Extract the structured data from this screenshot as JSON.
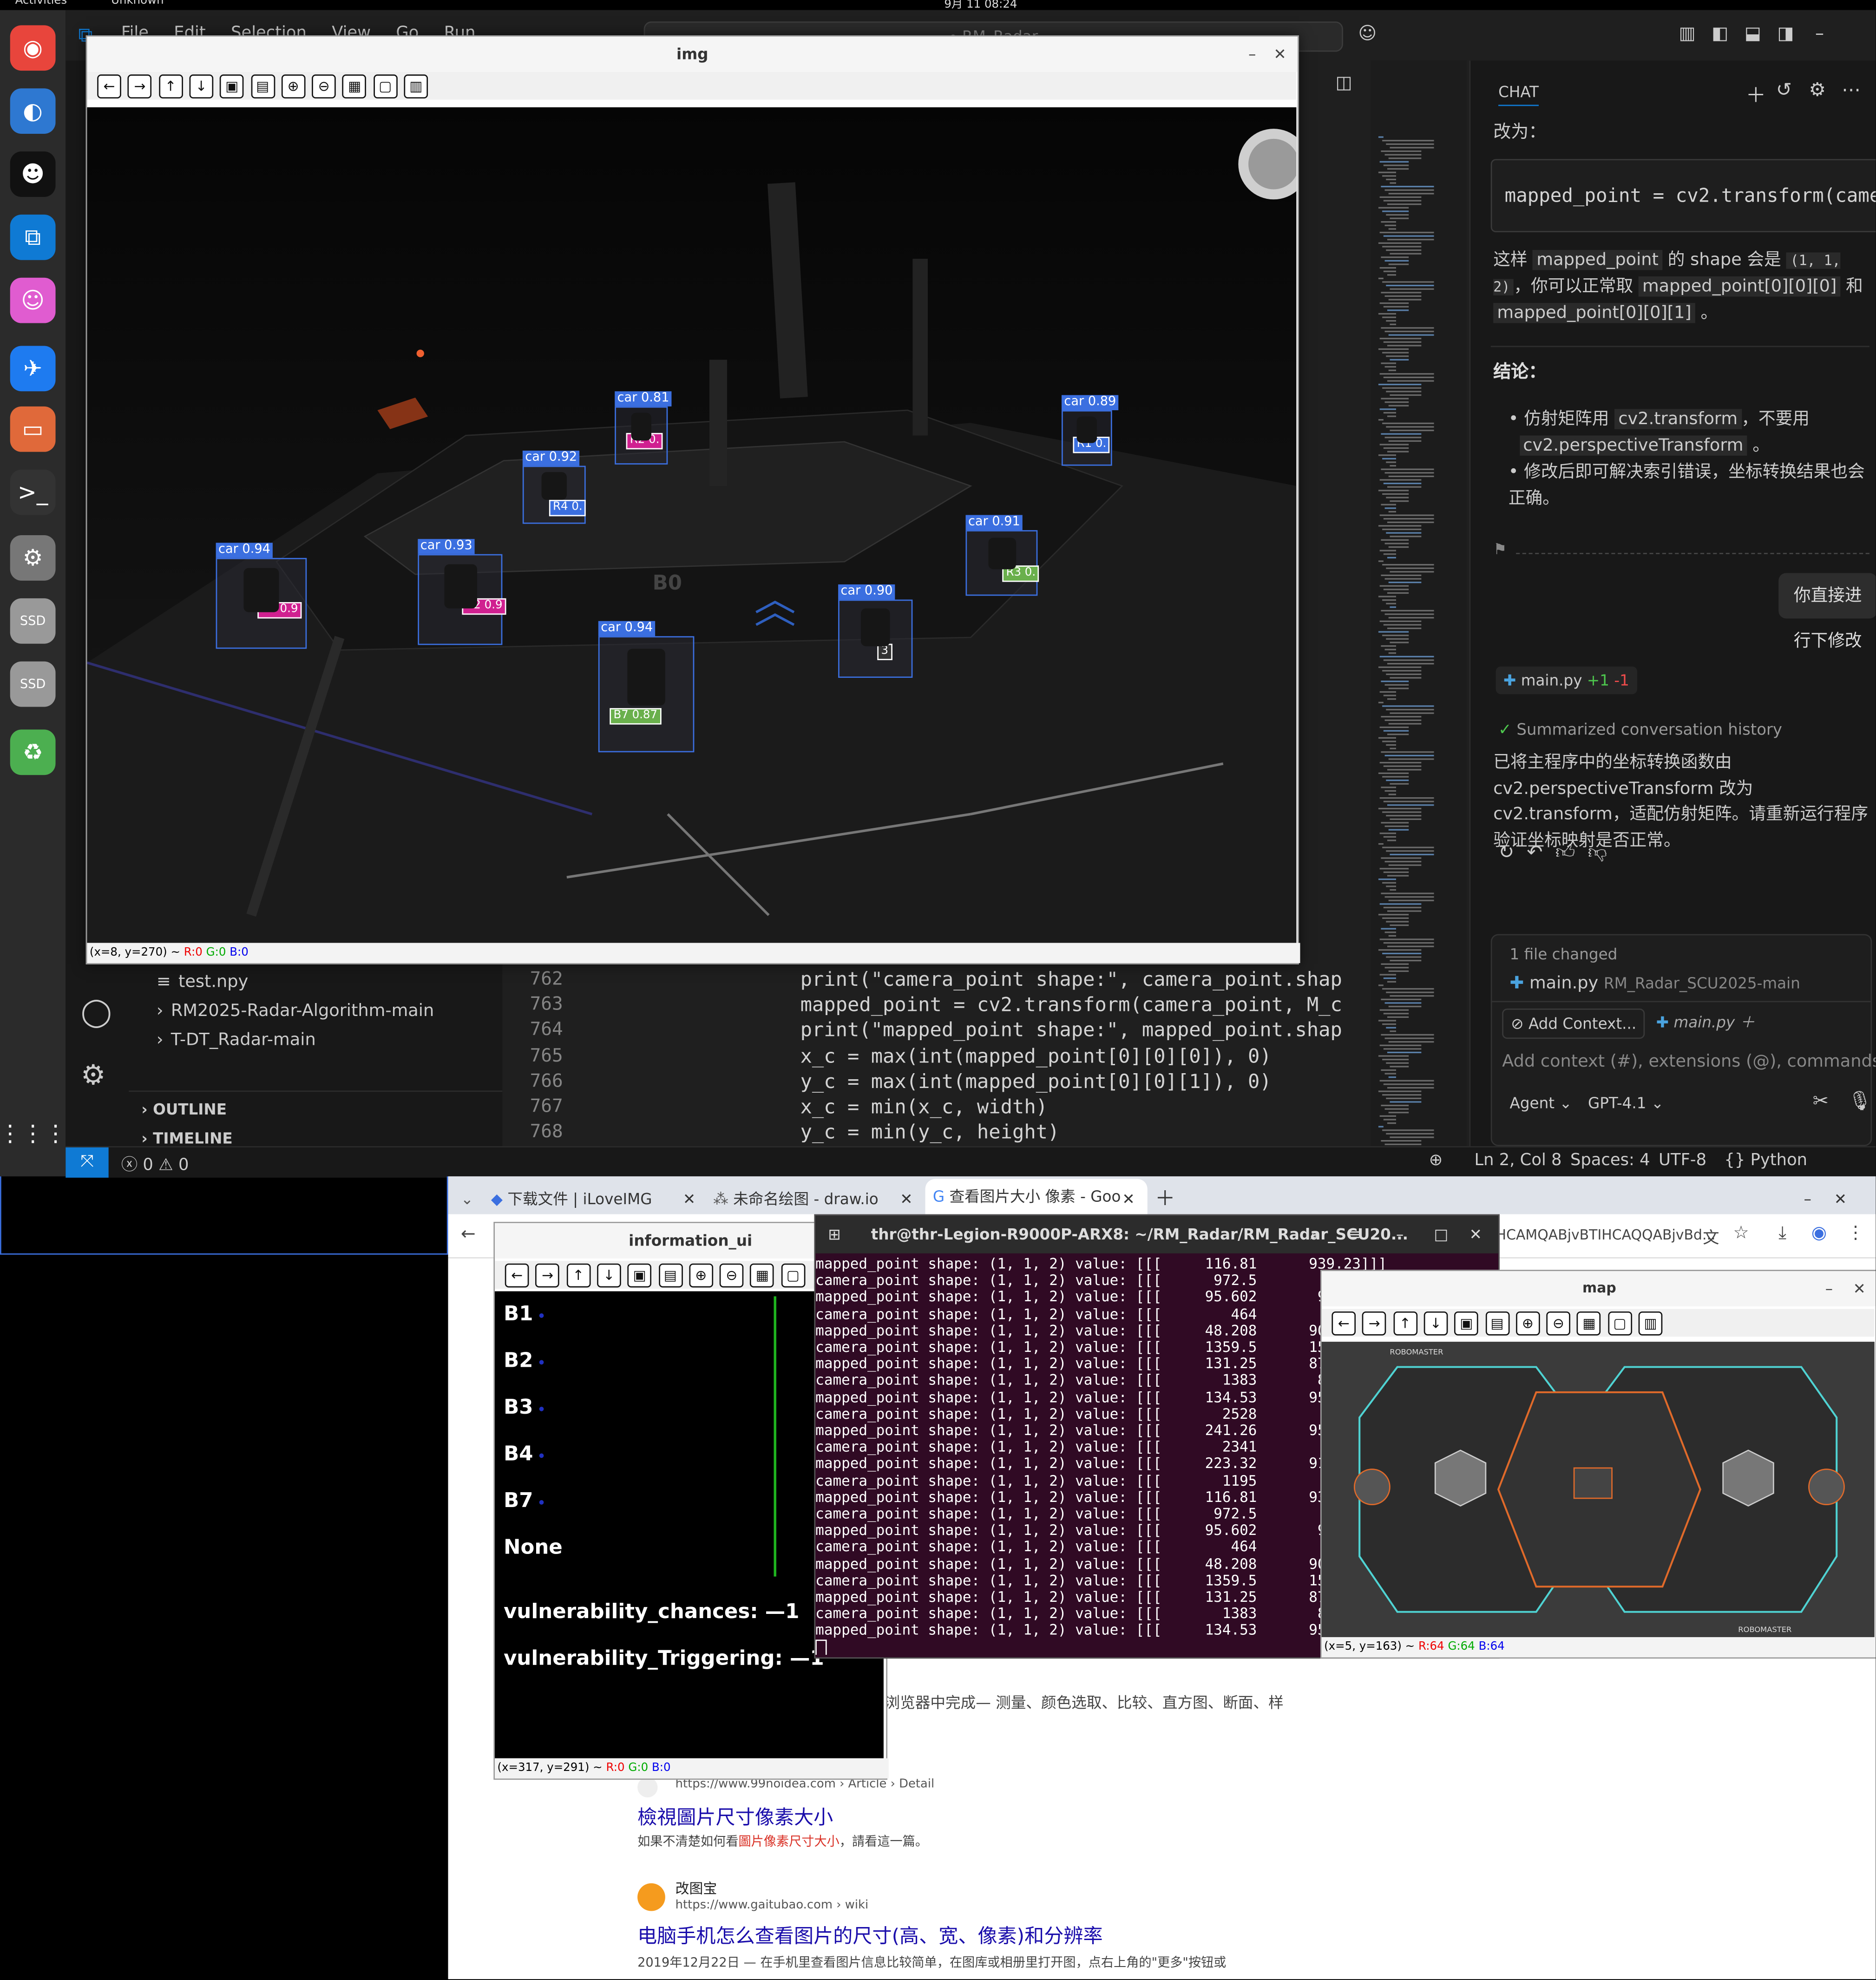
{
  "topbar": {
    "activities": "Activities",
    "app": "Unknown",
    "clock": "9月 11 08:24"
  },
  "dock": {
    "items": [
      {
        "name": "chrome-icon",
        "color": "#e8453c"
      },
      {
        "name": "thunderbird-icon",
        "color": "#2e78d1"
      },
      {
        "name": "qq-icon",
        "color": "#111"
      },
      {
        "name": "vscode-icon",
        "color": "#0f7ad4"
      },
      {
        "name": "cat-app-icon",
        "color": "#e05cd0"
      },
      {
        "name": "feishu-icon",
        "color": "#1e7bf0"
      },
      {
        "name": "files-icon",
        "color": "#e0693a"
      },
      {
        "name": "terminal-icon",
        "color": "#333"
      },
      {
        "name": "settings-icon",
        "color": "#777"
      },
      {
        "name": "ssd-drive-icon",
        "color": "#999",
        "label": "SSD"
      },
      {
        "name": "ssd-drive-icon",
        "color": "#999",
        "label": "SSD"
      },
      {
        "name": "trash-icon",
        "color": "#4caf50"
      },
      {
        "name": "app-grid-icon",
        "color": "#fff"
      }
    ]
  },
  "vscode": {
    "menu": [
      "File",
      "Edit",
      "Selection",
      "View",
      "Go",
      "Run"
    ],
    "search_placeholder": "RM_Radar",
    "explorer": [
      {
        "name": "test.npy",
        "icon": "≡"
      },
      {
        "name": "RM2025-Radar-Algorithm-main",
        "icon": "›"
      },
      {
        "name": "T-DT_Radar-main",
        "icon": "›"
      }
    ],
    "outline": "OUTLINE",
    "timeline": "TIMELINE",
    "line_numbers": [
      "762",
      "763",
      "764",
      "765",
      "766",
      "767",
      "768"
    ],
    "code": [
      "print(\"camera_point shape:\", camera_point.shap",
      "mapped_point = cv2.transform(camera_point, M_c",
      "print(\"mapped_point shape:\", mapped_point.shap",
      "x_c = max(int(mapped_point[0][0][0]), 0)",
      "y_c = max(int(mapped_point[0][0][1]), 0)",
      "x_c = min(x_c, width)",
      "y_c = min(y_c, height)"
    ],
    "status": {
      "errors": "0",
      "warnings": "0",
      "position": "Ln 2, Col 8",
      "spaces": "Spaces: 4",
      "encoding": "UTF-8",
      "language": "Python"
    }
  },
  "chat": {
    "header": "CHAT",
    "change_to": "改为：",
    "code_snippet": "mapped_point = cv2.transform(camera_po",
    "para1_a": "这样",
    "para1_b": "mapped_point",
    "para1_c": "的 shape 会是",
    "para1_d": "(1, 1, 2)",
    "para1_e": "，你可以正常取",
    "para1_f": "mapped_point[0][0][0]",
    "para1_g": "和",
    "para1_h": "mapped_point[0][0][1]",
    "para1_i": "。",
    "conclusion": "结论：",
    "bullet1_a": "仿射矩阵用",
    "bullet1_b": "cv2.transform",
    "bullet1_c": "，不要用",
    "bullet1_d": "cv2.perspectiveTransform",
    "bullet1_e": "。",
    "bullet2": "修改后即可解决索引错误，坐标转换结果也会正确。",
    "user_msg": "你直接进行下修改",
    "file_chip": "main.py",
    "plus": "+1",
    "minus": "-1",
    "summarized": "Summarized conversation history",
    "reply": "已将主程序中的坐标转换函数由 cv2.perspectiveTransform 改为 cv2.transform，适配仿射矩阵。请重新运行程序验证坐标映射是否正常。",
    "files_changed": "1 file changed",
    "changed_file": "main.py",
    "changed_path": "RM_Radar_SCU2025-main",
    "add_context": "Add Context...",
    "context_file": "main.py",
    "input_placeholder": "Add context (#), extensions (@), commands (/)",
    "mode": "Agent",
    "model": "GPT-4.1"
  },
  "img_window": {
    "title": "img",
    "coord_text": "(x=8, y=270) ~",
    "r": "R:0",
    "g": "G:0",
    "b": "B:0",
    "detections": [
      {
        "label": "car 0.81",
        "tag": "R2 0.",
        "tag_color": "#d02090"
      },
      {
        "label": "car 0.89",
        "tag": "R1 0.",
        "tag_color": "#3b6fe0"
      },
      {
        "label": "car 0.92",
        "tag": "R4 0.",
        "tag_color": "#3b6fe0"
      },
      {
        "label": "car 0.91",
        "tag": "R3 0.",
        "tag_color": "#6ab04c"
      },
      {
        "label": "car 0.94",
        "tag": "B1 0.9",
        "tag_color": "#d02090"
      },
      {
        "label": "car 0.93",
        "tag": "B2 0.9",
        "tag_color": "#d02090"
      },
      {
        "label": "car 0.90",
        "tag": "3",
        "tag_color": "#333"
      },
      {
        "label": "car 0.94",
        "tag": "B7 0.87",
        "tag_color": "#6ab04c"
      }
    ],
    "floor_text": "B0"
  },
  "browser": {
    "tabs": [
      {
        "label": "下载文件 | iLoveIMG"
      },
      {
        "label": "未命名绘图 - draw.io"
      },
      {
        "label": "查看图片大小 像素 - Goo"
      }
    ],
    "url_fragment": "HCAMQABjvBTIHCAQQABjvBd...",
    "snippet_top": "浏览器中完成— 测量、颜色选取、比较、直方图、断面、样",
    "result1": {
      "url": "https://www.99noidea.com › Article › Detail",
      "title": "檢視圖片尺寸像素大小",
      "desc_a": "如果不清楚如何看",
      "desc_b": "圖片像素尺寸大小",
      "desc_c": "，請看這一篇。"
    },
    "result2": {
      "site": "改图宝",
      "url": "https://www.gaitubao.com › wiki",
      "title": "电脑手机怎么查看图片的尺寸(高、宽、像素)和分辨率",
      "desc": "2019年12月22日 — 在手机里查看图片信息比较简单，在图库或相册里打开图，点右上角的\"更多\"按钮或"
    }
  },
  "terminal": {
    "title": "thr@thr-Legion-R9000P-ARX8: ~/RM_Radar/RM_Radar_SCU20...",
    "lines": [
      "mapped_point shape: (1, 1, 2) value: [[[     116.81      939.23]]]",
      "camera_point shape: (1, 1, 2) value: [[[      972.5        1",
      "mapped_point shape: (1, 1, 2) value: [[[     95.602       90",
      "camera_point shape: (1, 1, 2) value: [[[        464        1",
      "mapped_point shape: (1, 1, 2) value: [[[     48.208      905",
      "camera_point shape: (1, 1, 2) value: [[[     1359.5      156",
      "mapped_point shape: (1, 1, 2) value: [[[     131.25      870",
      "camera_point shape: (1, 1, 2) value: [[[       1383       87",
      "mapped_point shape: (1, 1, 2) value: [[[     134.53      954",
      "camera_point shape: (1, 1, 2) value: [[[       2528        ",
      "mapped_point shape: (1, 1, 2) value: [[[     241.26      951",
      "camera_point shape: (1, 1, 2) value: [[[       2341        1",
      "mapped_point shape: (1, 1, 2) value: [[[     223.32      913",
      "camera_point shape: (1, 1, 2) value: [[[       1195        1",
      "mapped_point shape: (1, 1, 2) value: [[[     116.81      939",
      "camera_point shape: (1, 1, 2) value: [[[      972.5        1",
      "mapped_point shape: (1, 1, 2) value: [[[     95.602       90",
      "camera_point shape: (1, 1, 2) value: [[[        464        1",
      "mapped_point shape: (1, 1, 2) value: [[[     48.208      905",
      "camera_point shape: (1, 1, 2) value: [[[     1359.5      156",
      "mapped_point shape: (1, 1, 2) value: [[[     131.25      870",
      "camera_point shape: (1, 1, 2) value: [[[       1383       87",
      "mapped_point shape: (1, 1, 2) value: [[[     134.53      954"
    ]
  },
  "info_window": {
    "title": "information_ui",
    "items": [
      "B1",
      "B2",
      "B3",
      "B4",
      "B7",
      "None"
    ],
    "vuln_chances": "vulnerability_chances: —1",
    "vuln_triggering": "vulnerability_Triggering: —1",
    "coord_text": "(x=317, y=291) ~",
    "r": "R:0",
    "g": "G:0",
    "b": "B:0"
  },
  "map_window": {
    "title": "map",
    "brand": "ROBOMASTER",
    "coord_text": "(x=5, y=163) ~",
    "r": "R:64",
    "g": "G:64",
    "b": "B:64"
  }
}
